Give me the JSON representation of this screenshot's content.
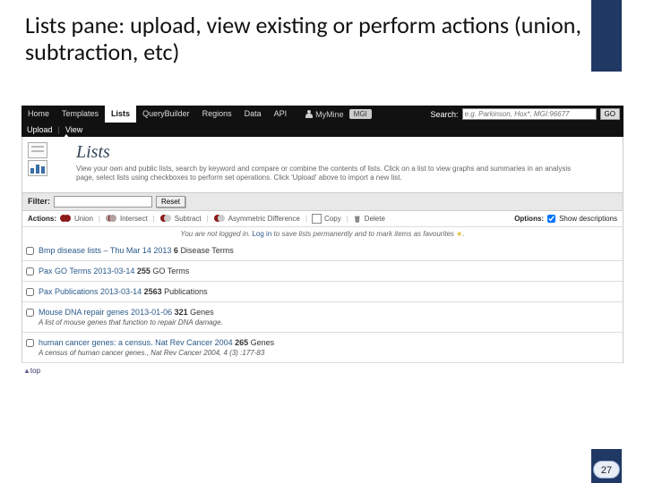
{
  "slide": {
    "title": "Lists pane: upload, view existing or perform actions (union, subtraction, etc)",
    "page": "27"
  },
  "nav": {
    "tabs": [
      "Home",
      "Templates",
      "Lists",
      "QueryBuilder",
      "Regions",
      "Data",
      "API"
    ],
    "active": "Lists",
    "my": "MyMine",
    "brand": "MGI",
    "search_label": "Search:",
    "search_placeholder": "e.g. Parkinson, Hox*, MGI:96677",
    "go": "GO"
  },
  "subnav": {
    "upload": "Upload",
    "view": "View"
  },
  "lists_header": {
    "title": "Lists",
    "desc": "View your own and public lists, search by keyword and compare or combine the contents of lists. Click on a list to view graphs and summaries in an analysis page, select lists using checkboxes to perform set operations. Click 'Upload' above to import a new list."
  },
  "filter": {
    "label": "Filter:",
    "reset": "Reset"
  },
  "actions": {
    "label": "Actions:",
    "union": "Union",
    "intersect": "Intersect",
    "subtract": "Subtract",
    "asym": "Asymmetric Difference",
    "copy": "Copy",
    "del": "Delete",
    "options_label": "Options:",
    "show_desc": "Show descriptions"
  },
  "login_msg": {
    "pre": "You are not logged in. ",
    "link": "Log in",
    "post": " to save lists permanently and to mark items as favourites "
  },
  "rows": [
    {
      "name": "Bmp disease lists – Thu Mar 14 2013",
      "count": "6",
      "type": "Disease Terms",
      "desc": ""
    },
    {
      "name": "Pax GO Terms 2013-03-14",
      "count": "255",
      "type": "GO Terms",
      "desc": ""
    },
    {
      "name": "Pax Publications 2013-03-14",
      "count": "2563",
      "type": "Publications",
      "desc": ""
    },
    {
      "name": "Mouse DNA repair genes 2013-01-06",
      "count": "321",
      "type": "Genes",
      "desc": "A list of mouse genes that function to repair DNA damage."
    },
    {
      "name": "human cancer genes: a census. Nat Rev Cancer 2004",
      "count": "265",
      "type": "Genes",
      "desc": "A census of human cancer genes., Nat Rev Cancer 2004, 4 (3) :177-83"
    }
  ],
  "top": "top"
}
